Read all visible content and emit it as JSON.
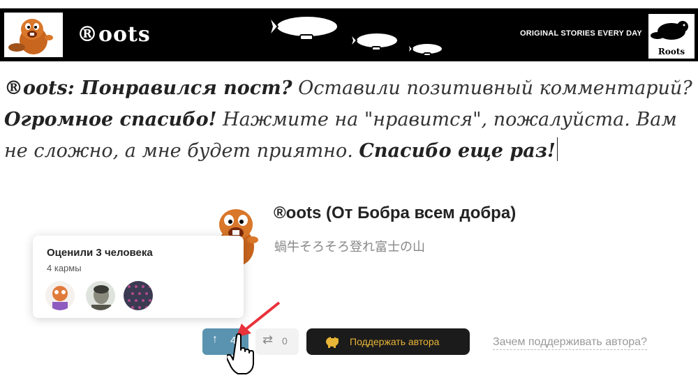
{
  "banner": {
    "brand": "®oots",
    "tagline": "ORIGINAL STORIES EVERY DAY",
    "right_logo_word": "Roots"
  },
  "message": {
    "part1_bold": "®oots: Понравился пост?",
    "part2": " Оставили позитивный комментарий? ",
    "part3_bold": "Огромное спасибо!",
    "part4": " Нажмите на \"нравится\", пожалуйста. Вам не сложно, а мне будет приятно. ",
    "part5_bold": "Спасибо еще раз!"
  },
  "author": {
    "name": "®oots (От Бобра всем добра)",
    "subtitle": "蝸牛そろそろ登れ富士の山"
  },
  "popup": {
    "title": "Оценили 3 человека",
    "karma": "4 кармы"
  },
  "actions": {
    "vote_count": "4",
    "repost_count": "0",
    "support_label": "Поддержать автора",
    "why_label": "Зачем поддерживать автора?"
  },
  "colors": {
    "vote_bg": "#5a93b0",
    "support_bg": "#1b1b1b",
    "support_text": "#e8b537",
    "arrow_red": "#e8323c"
  }
}
